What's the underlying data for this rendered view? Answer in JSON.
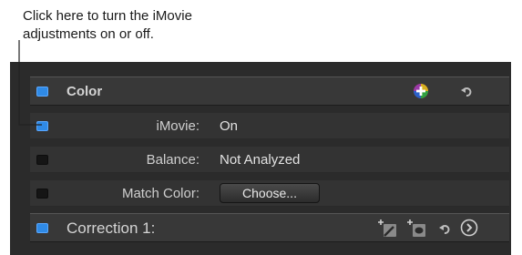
{
  "callout": {
    "line1": "Click here to turn the iMovie",
    "line2": "adjustments on or off."
  },
  "color_section": {
    "title": "Color",
    "enabled": true,
    "add_icon": "color-wheel-add-icon",
    "reset_icon": "reset-arrow-icon"
  },
  "parameters": [
    {
      "label": "iMovie:",
      "value": "On",
      "enabled": true
    },
    {
      "label": "Balance:",
      "value": "Not Analyzed",
      "enabled": false
    },
    {
      "label": "Match Color:",
      "button_label": "Choose...",
      "enabled": false
    }
  ],
  "correction": {
    "title": "Correction 1:",
    "enabled": true,
    "icons": [
      "magic-wand-add-icon",
      "mask-add-icon",
      "reset-arrow-icon",
      "show-arrow-icon"
    ]
  },
  "colors": {
    "checkbox_on": "#2f8ae6",
    "panel_bg": "#2b2b2b"
  }
}
